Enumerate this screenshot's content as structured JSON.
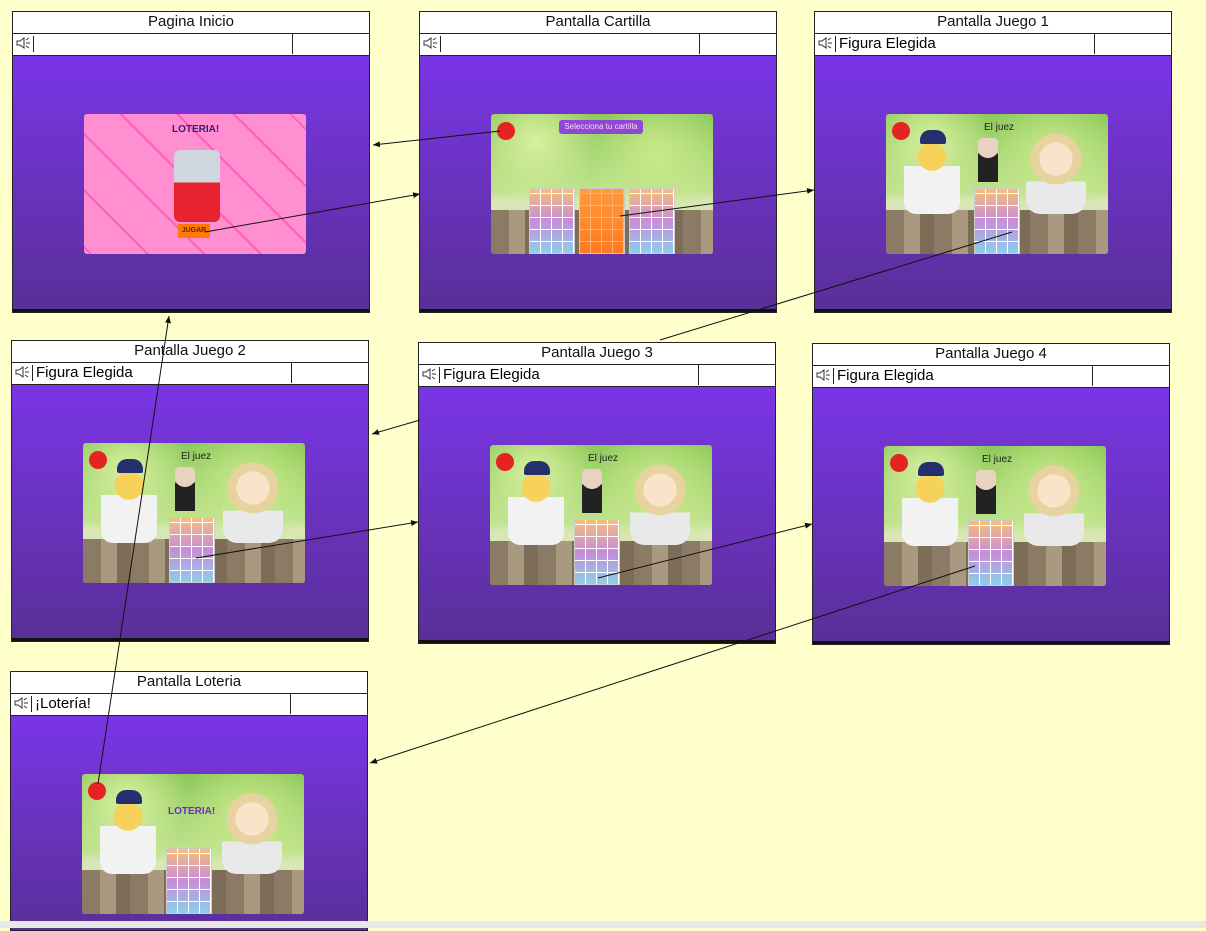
{
  "screens": [
    {
      "id": "inicio",
      "title": "Pagina Inicio",
      "bar_text": ""
    },
    {
      "id": "cartilla",
      "title": "Pantalla Cartilla",
      "bar_text": ""
    },
    {
      "id": "juego1",
      "title": "Pantalla Juego 1",
      "bar_text": "Figura Elegida"
    },
    {
      "id": "juego2",
      "title": "Pantalla Juego 2",
      "bar_text": "Figura Elegida"
    },
    {
      "id": "juego3",
      "title": "Pantalla Juego 3",
      "bar_text": "Figura Elegida"
    },
    {
      "id": "juego4",
      "title": "Pantalla Juego 4",
      "bar_text": "Figura Elegida"
    },
    {
      "id": "loteria",
      "title": "Pantalla Loteria",
      "bar_text": "¡Lotería!"
    }
  ],
  "thumb_text": {
    "inicio_title": "LOTERIA!",
    "inicio_button": "JUGAR",
    "cartilla_prompt": "Selecciona tu cartilla",
    "juego_caller": "El juez",
    "loteria_title": "LOTERIA!"
  },
  "colors": {
    "background": "#ffffcc",
    "screen_gradient_top": "#7a35e6",
    "screen_gradient_bottom": "#5a2f98"
  }
}
